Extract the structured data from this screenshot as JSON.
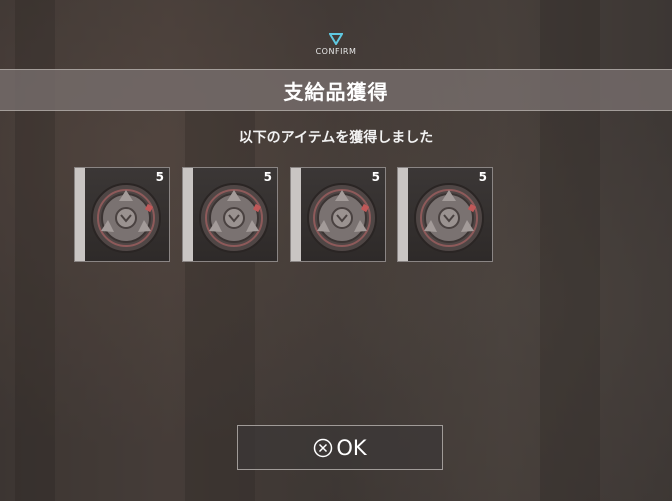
{
  "header": {
    "confirm_icon": "triangle-down-icon",
    "confirm_label": "CONFIRM",
    "title": "支給品獲得"
  },
  "message": "以下のアイテムを獲得しました",
  "items": [
    {
      "icon": "supply-canister-icon",
      "count": "5"
    },
    {
      "icon": "supply-canister-icon",
      "count": "5"
    },
    {
      "icon": "supply-canister-icon",
      "count": "5"
    },
    {
      "icon": "supply-canister-icon",
      "count": "5"
    }
  ],
  "ok_button": {
    "icon": "circle-x-icon",
    "label": "OK"
  },
  "colors": {
    "accent": "#5fc8e0",
    "title_bar": "#78706e",
    "item_strip": "#c9c5c3"
  }
}
